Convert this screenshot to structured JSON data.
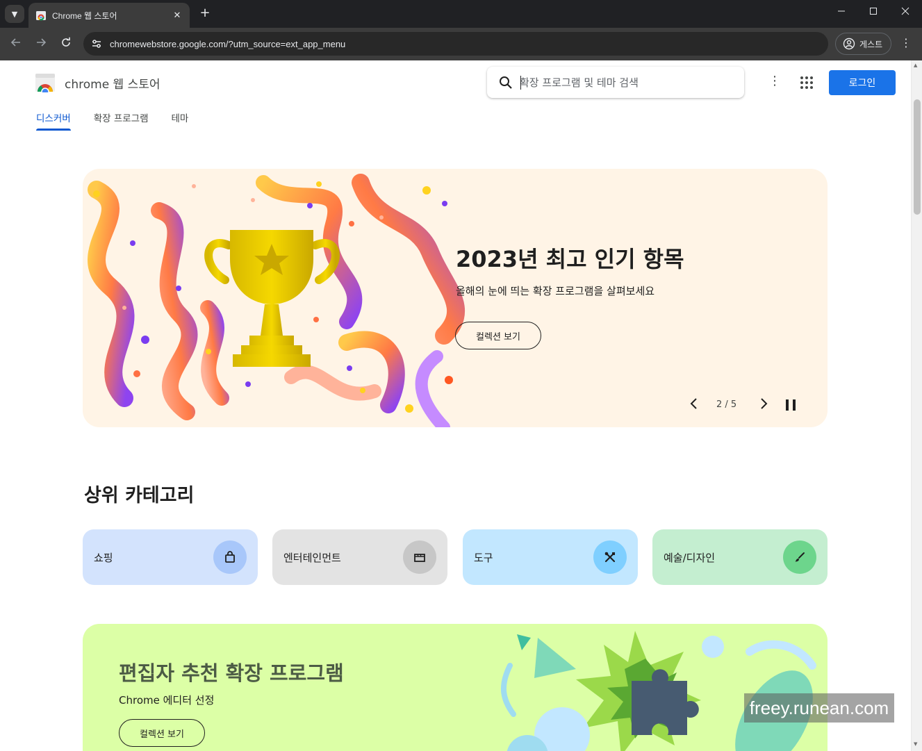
{
  "browser": {
    "tab_title": "Chrome 웹 스토어",
    "close_glyph": "✕",
    "new_tab_glyph": "+",
    "url": "chromewebstore.google.com/?utm_source=ext_app_menu",
    "profile_label": "게스트",
    "icons": [
      "tab-search-icon",
      "back-icon",
      "forward-icon",
      "reload-icon",
      "site-info-icon",
      "profile-icon",
      "menu-icon",
      "minimize-icon",
      "maximize-icon",
      "close-icon"
    ]
  },
  "header": {
    "brand": "chrome 웹 스토어",
    "search_placeholder": "확장 프로그램 및 테마 검색",
    "login_label": "로그인",
    "login_color": "#1a73e8"
  },
  "nav": {
    "tabs": [
      {
        "label": "디스커버",
        "active": true
      },
      {
        "label": "확장 프로그램",
        "active": false
      },
      {
        "label": "테마",
        "active": false
      }
    ],
    "active_color": "#0b57d0"
  },
  "hero": {
    "title": "2023년 최고 인기 항목",
    "subtitle": "올해의 눈에 띄는 확장 프로그램을 살펴보세요",
    "button_label": "컬렉션 보기",
    "counter": "2 / 5",
    "background": "#fff4e6"
  },
  "categories": {
    "title": "상위 카테고리",
    "items": [
      {
        "label": "쇼핑",
        "bg": "#d3e3fd",
        "icon_bg": "#a8c7fa",
        "icon": "shopping-bag-icon"
      },
      {
        "label": "엔터테인먼트",
        "bg": "#e3e3e3",
        "icon_bg": "#c7c7c7",
        "icon": "clapperboard-icon"
      },
      {
        "label": "도구",
        "bg": "#c2e7ff",
        "icon_bg": "#7fcfff",
        "icon": "tools-icon"
      },
      {
        "label": "예술/디자인",
        "bg": "#c4eed0",
        "icon_bg": "#6dd58c",
        "icon": "brush-icon"
      }
    ]
  },
  "editor": {
    "title": "편집자 추천 확장 프로그램",
    "subtitle": "Chrome 에디터 선정",
    "button_label": "컬렉션 보기",
    "background": "#dcffa6"
  },
  "watermark": "freey.runean.com"
}
